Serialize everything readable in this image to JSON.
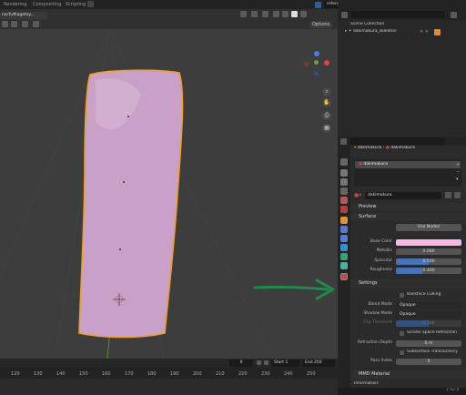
{
  "topbar": {
    "tabs": [
      "Rendering",
      "Compositing",
      "Scripting"
    ],
    "scene_name": "reference",
    "view_layer": "View Layer"
  },
  "file_tab": "nsct\\dhagetoy...",
  "viewport": {
    "options_label": "Options"
  },
  "outliner": {
    "root": "Scene Collection",
    "item": "dakimakura_skeleton"
  },
  "properties": {
    "object_name": "dakimakura",
    "data_name": "dakimakura",
    "material_slot": "dakimakura",
    "material_name": "dakimakura",
    "sections": {
      "preview": "Preview",
      "surface": "Surface",
      "settings": "Settings",
      "mmd": "MMD Material"
    },
    "use_nodes": "Use Nodes",
    "surface_fields": [
      {
        "label": "Base Color",
        "value": ""
      },
      {
        "label": "Metallic",
        "value": "0.000"
      },
      {
        "label": "Specular",
        "value": "0.500"
      },
      {
        "label": "Roughness",
        "value": "0.400"
      }
    ],
    "base_color": "#f4b8e4",
    "settings_fields": {
      "backface_culling": "Backface Culling",
      "blend_mode_label": "Blend Mode",
      "blend_mode_value": "Opaque",
      "shadow_mode_label": "Shadow Mode",
      "shadow_mode_value": "Opaque",
      "clip_threshold_label": "Clip Threshold",
      "clip_threshold_value": "0.500",
      "ssr": "Screen Space Refraction",
      "refraction_depth_label": "Refraction Depth",
      "refraction_depth_value": "0 m",
      "sss": "Subsurface Translucency",
      "pass_index_label": "Pass Index",
      "pass_index_value": "0"
    },
    "information_label": "Information:"
  },
  "timeline": {
    "ticks": [
      "120",
      "130",
      "140",
      "150",
      "160",
      "170",
      "180",
      "190",
      "200",
      "210",
      "220",
      "230",
      "240",
      "250"
    ],
    "current_frame": "0",
    "start_label": "Start",
    "start_value": "1",
    "end_label": "End",
    "end_value": "250",
    "version": "2.92.0"
  },
  "colors": {
    "pillow": "#c9a0c7",
    "outline": "#f0a020",
    "annotation_arrow": "#1f8a4c"
  }
}
